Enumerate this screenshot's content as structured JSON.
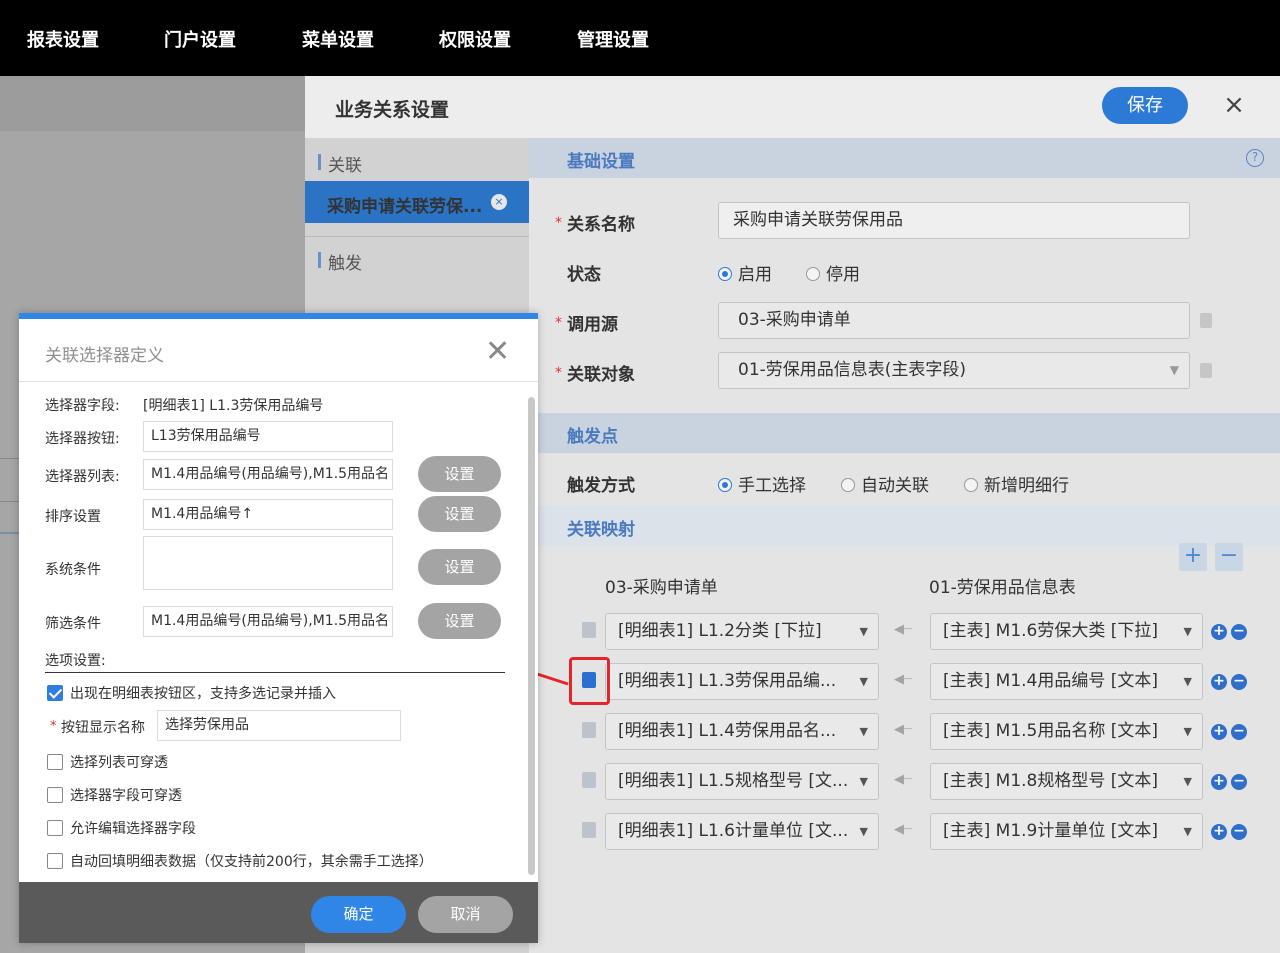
{
  "topnav": [
    "报表设置",
    "门户设置",
    "菜单设置",
    "权限设置",
    "管理设置"
  ],
  "panel": {
    "title": "业务关系设置",
    "save": "保存",
    "close": "×"
  },
  "sidebar": {
    "relation_section": "关联",
    "active_item": "采购申请关联劳保...",
    "active_close": "×",
    "trigger_section": "触发"
  },
  "basic": {
    "section": "基础设置",
    "help": "?",
    "name_label": "关系名称",
    "name_value": "采购申请关联劳保用品",
    "status_label": "状态",
    "status_on": "启用",
    "status_off": "停用",
    "source_label": "调用源",
    "source_value": "03-采购申请单",
    "target_label": "关联对象",
    "target_value": "01-劳保用品信息表(主表字段)"
  },
  "trigger": {
    "section": "触发点",
    "mode_label": "触发方式",
    "opt_manual": "手工选择",
    "opt_auto": "自动关联",
    "opt_newrow": "新增明细行"
  },
  "mapping": {
    "section": "关联映射",
    "plus": "+",
    "minus": "−",
    "left_head": "03-采购申请单",
    "right_head": "01-劳保用品信息表",
    "rows": [
      {
        "left": "[明细表1] L1.2分类 [下拉]",
        "right": "[主表] M1.6劳保大类 [下拉]"
      },
      {
        "left": "[明细表1] L1.3劳保用品编...",
        "right": "[主表] M1.4用品编号 [文本]"
      },
      {
        "left": "[明细表1] L1.4劳保用品名...",
        "right": "[主表] M1.5用品名称 [文本]"
      },
      {
        "left": "[明细表1] L1.5规格型号 [文...",
        "right": "[主表] M1.8规格型号 [文本]"
      },
      {
        "left": "[明细表1] L1.6计量单位 [文...",
        "right": "[主表] M1.9计量单位 [文本]"
      }
    ]
  },
  "dialog": {
    "title": "关联选择器定义",
    "close": "✕",
    "field_label": "选择器字段:",
    "field_value": "[明细表1] L1.3劳保用品编号",
    "button_label": "选择器按钮:",
    "button_value": "L13劳保用品编号",
    "list_label": "选择器列表:",
    "list_value": "M1.4用品编号(用品编号),M1.5用品名",
    "sort_label": "排序设置",
    "sort_value": "M1.4用品编号↑",
    "syscond_label": "系统条件",
    "syscond_value": "",
    "filter_label": "筛选条件",
    "filter_value": "M1.4用品编号(用品编号),M1.5用品名",
    "set": "设置",
    "options_label": "选项设置:",
    "opt1": "出现在明细表按钮区，支持多选记录并插入",
    "btnname_label": "按钮显示名称",
    "btnname_value": "选择劳保用品",
    "opt2": "选择列表可穿透",
    "opt3": "选择器字段可穿透",
    "opt4": "允许编辑选择器字段",
    "opt5": "自动回填明细表数据（仅支持前200行，其余需手工选择）",
    "ok": "确定",
    "cancel": "取消"
  },
  "colors": {
    "accent": "#2d79d6",
    "annotation": "#e3262b"
  }
}
